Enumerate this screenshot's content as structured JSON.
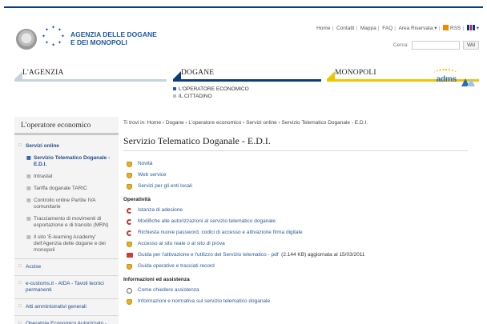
{
  "header": {
    "brand_line1": "AGENZIA DELLE DOGANE",
    "brand_line2": "E DEI MONOPOLI",
    "links": [
      "Home",
      "Contatti",
      "Mappa",
      "FAQ",
      "Area Riservata ▾"
    ],
    "rss": "RSS",
    "lang": "▾",
    "search_label": "Cerca:",
    "search_button": "VAI",
    "search_value": ""
  },
  "nav": {
    "agenzia": "L'AGENZIA",
    "dogane": "DOGANE",
    "monopoli": "MONOPOLI",
    "dogane_sub": [
      "L'OPERATORE ECONOMICO",
      "IL CITTADINO"
    ],
    "adm": "adms",
    "colors": {
      "agenzia": "#c9d2d9",
      "dogane": "#0b3f73",
      "monopoli": "#f2c400"
    }
  },
  "sidebar": {
    "title": "L'operatore economico",
    "items": [
      {
        "label": "Servizi online"
      },
      {
        "label": "Accise"
      },
      {
        "label": "e-customs.it - AIDA - Tavoli tecnici permanenti"
      },
      {
        "label": "Atti amministrativi generali"
      },
      {
        "label": "Operatore Economico Autorizzato - AEO"
      }
    ],
    "subitems": [
      {
        "label": "Servizio Telematico Doganale - E.D.I."
      },
      {
        "label": "Intrastat"
      },
      {
        "label": "Tariffa doganale TARIC"
      },
      {
        "label": "Controllo online Partite IVA comunitarie"
      },
      {
        "label": "Tracciamento di movimenti di esportazione e di transito (MRN)"
      },
      {
        "label": "Il sito 'E-learning Academy' dell'Agenzia delle dogane e dei monopoli"
      }
    ]
  },
  "main": {
    "breadcrumb": "Ti trovi in: Home › Dogane › L'operatore economico › Servizi online › Servizio Telematico Doganale - E.D.I.",
    "title": "Servizio Telematico Doganale - E.D.I.",
    "rows1": [
      "Novità",
      "Web service",
      "Servizi per gli enti locali"
    ],
    "section1": "Operatività",
    "rows2": [
      "Istanza di adesione",
      "Modifiche alle autorizzazioni al servizio telematico doganale",
      "Richiesta nuove password, codici di accesso e attivazione firma digitale",
      "Accesso al sito reale o al sito di prova"
    ],
    "pdf_row": "Guida per l'attivazione e l'utilizzo del Servizio telematico - pdf",
    "pdf_meta": "(2.144 KB) aggiornata al 15/03/2011",
    "row_after_pdf": "Guida operative e tracciati record",
    "section2": "Informazioni ed assistenza",
    "rows3": [
      "Come chiedere assistenza",
      "Informazioni e normativa sul servizio telematico doganale"
    ]
  }
}
